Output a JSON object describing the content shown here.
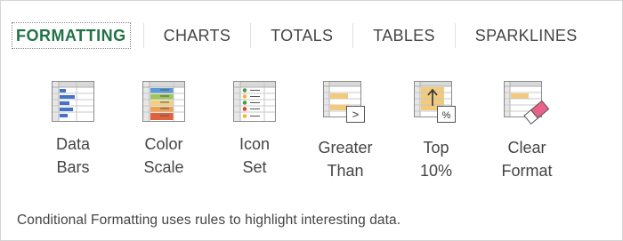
{
  "tabs": [
    {
      "label": "FORMATTING",
      "active": true
    },
    {
      "label": "CHARTS",
      "active": false
    },
    {
      "label": "TOTALS",
      "active": false
    },
    {
      "label": "TABLES",
      "active": false
    },
    {
      "label": "SPARKLINES",
      "active": false
    }
  ],
  "tools": [
    {
      "line1": "Data",
      "line2": "Bars",
      "icon": "data-bars-icon"
    },
    {
      "line1": "Color",
      "line2": "Scale",
      "icon": "color-scale-icon"
    },
    {
      "line1": "Icon",
      "line2": "Set",
      "icon": "icon-set-icon"
    },
    {
      "line1": "Greater",
      "line2": "Than",
      "icon": "greater-than-icon",
      "badge": ">"
    },
    {
      "line1": "Top",
      "line2": "10%",
      "icon": "top-ten-percent-icon",
      "badge": "%"
    },
    {
      "line1": "Clear",
      "line2": "Format",
      "icon": "clear-format-icon"
    }
  ],
  "footer": "Conditional Formatting uses rules to highlight interesting data.",
  "colors": {
    "accent": "#217346",
    "text": "#444444",
    "border": "#d4d4d4"
  }
}
